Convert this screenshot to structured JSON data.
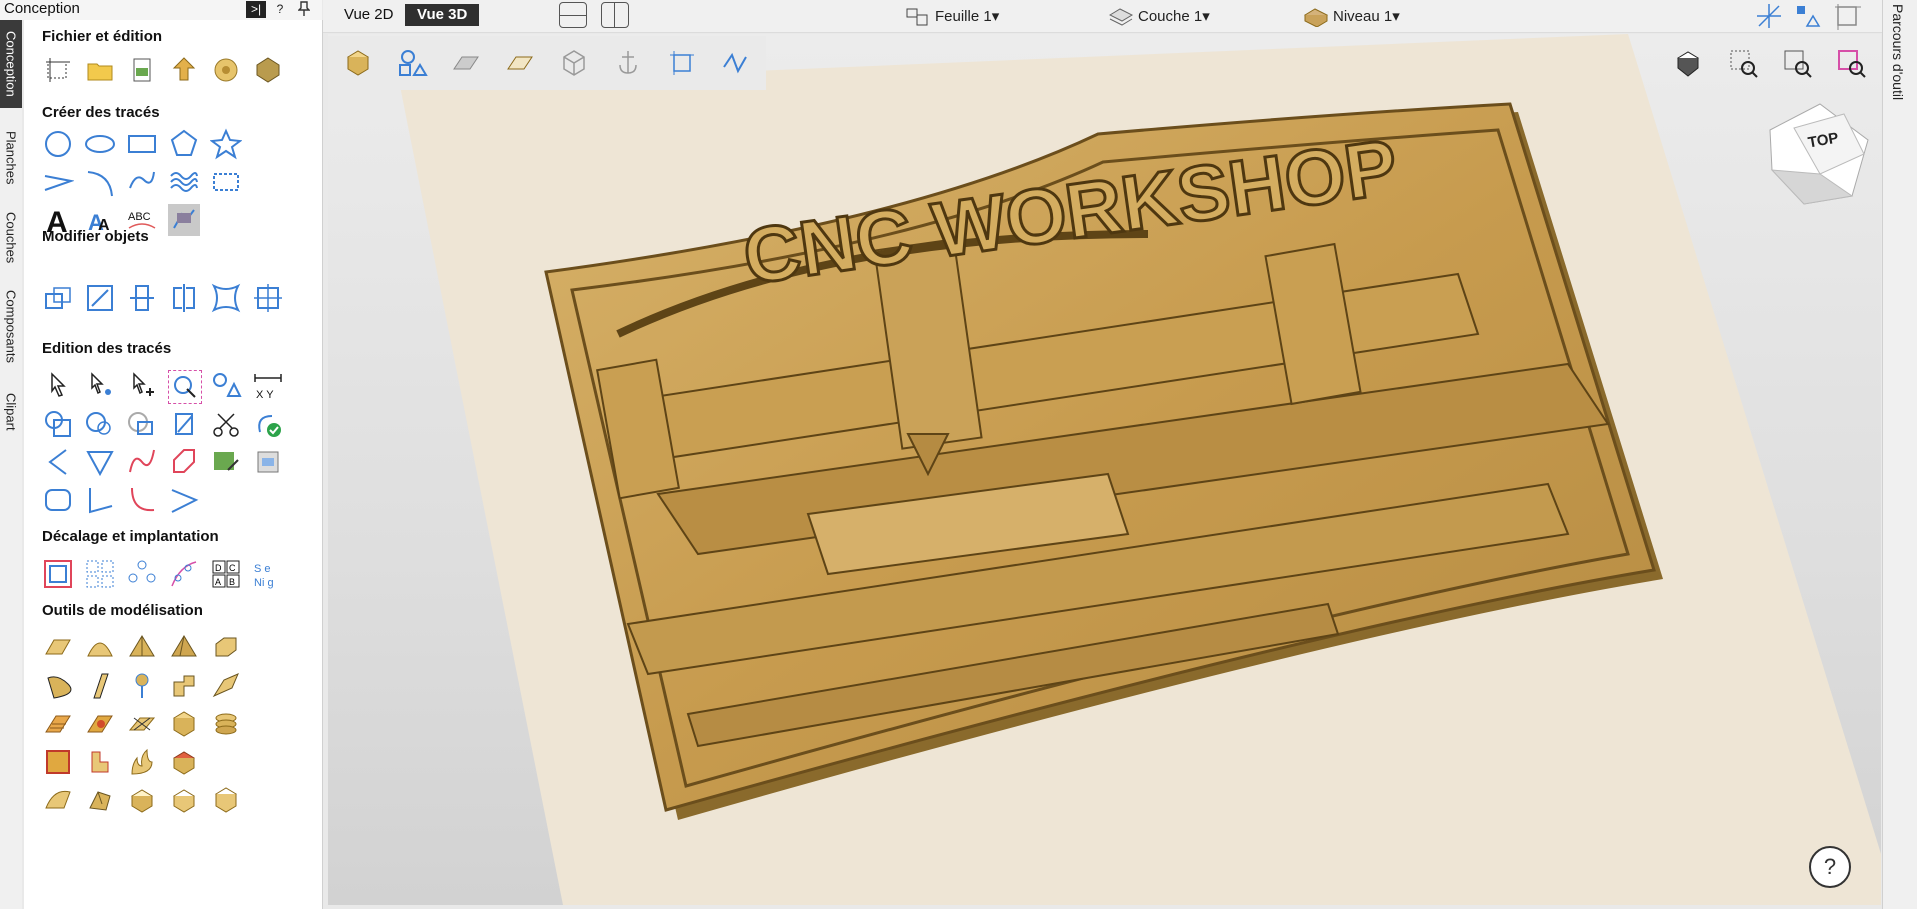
{
  "panel": {
    "title": "Conception",
    "pin_button": ">|",
    "help_button": "?",
    "pin_icon": "pin-icon"
  },
  "vertical_tabs": [
    "Conception",
    "Planches",
    "Couches",
    "Composants",
    "Clipart"
  ],
  "sections": {
    "fichier": "Fichier et édition",
    "creer": "Créer des tracés",
    "modifier": "Modifier objets",
    "edition": "Edition des tracés",
    "decalage": "Décalage et implantation",
    "outils": "Outils de modélisation"
  },
  "topbar": {
    "vue2d": "Vue 2D",
    "vue3d": "Vue 3D",
    "feuille": "Feuille 1",
    "couche": "Couche 1",
    "niveau": "Niveau 1"
  },
  "right_tab": "Parcours d'outil",
  "cube_label": "TOP",
  "sign_text": "CNC WORKSHOP",
  "help_label": "?",
  "colors": {
    "accent_blue": "#3b7fd4",
    "active_tab": "#3a3a3a",
    "wood": "#c9a25a",
    "wood_dark": "#7a5a22"
  }
}
